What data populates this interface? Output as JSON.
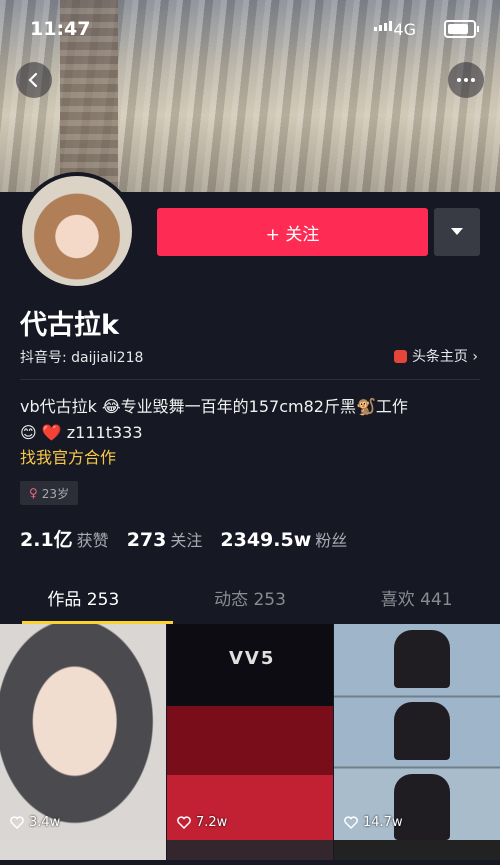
{
  "status_bar": {
    "time": "11:47",
    "network": "4G"
  },
  "header": {
    "back_icon": "back-arrow-icon",
    "more_icon": "more-dots-icon"
  },
  "profile": {
    "follow_label": "+ 关注",
    "name": "代古拉k",
    "douyin_id": "抖音号: daijiali218",
    "toutiao_label": "头条主页 ›",
    "bio_line1": "vb代古拉k 😂专业毁舞一百年的157cm82斤黑🐒工作",
    "bio_line2": "😊 ❤️ z111t333",
    "bio_link": "找我官方合作",
    "age_tag": "23岁",
    "stats": [
      {
        "value": "2.1亿",
        "label": "获赞"
      },
      {
        "value": "273",
        "label": "关注"
      },
      {
        "value": "2349.5w",
        "label": "粉丝"
      }
    ]
  },
  "tabs": [
    {
      "label": "作品 253",
      "active": true
    },
    {
      "label": "动态 253",
      "active": false
    },
    {
      "label": "喜欢 441",
      "active": false
    }
  ],
  "videos": [
    {
      "likes": "3.4w"
    },
    {
      "likes": "7.2w",
      "logo_text": "VV5"
    },
    {
      "likes": "14.7w"
    }
  ],
  "colors": {
    "background": "#161823",
    "accent": "#fe2c55",
    "link": "#f7c94a",
    "tab_indicator": "#fcd22e"
  }
}
